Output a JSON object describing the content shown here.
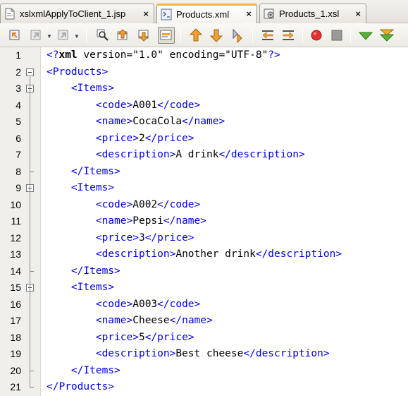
{
  "tabs": [
    {
      "label": "xslxmlApplyToClient_1.jsp",
      "icon": "jsp-file-icon",
      "active": false
    },
    {
      "label": "Products.xml",
      "icon": "xml-file-icon",
      "active": true
    },
    {
      "label": "Products_1.xsl",
      "icon": "xsl-file-icon",
      "active": false
    }
  ],
  "tab_close_glyph": "×",
  "toolbar": {
    "buttons": [
      "back-icon",
      "forward-icon",
      "history-icon",
      "find-icon",
      "find-previous-icon",
      "find-next-icon",
      "toggle-highlight-icon",
      "previous-bookmark-icon",
      "next-bookmark-icon",
      "toggle-bookmark-icon",
      "shift-left-icon",
      "shift-right-icon",
      "record-macro-icon",
      "stop-macro-icon",
      "check-xml-icon",
      "validate-xml-icon"
    ],
    "colors": {
      "arrow_orange": "#f0a030",
      "record_red": "#e03030",
      "validate_green": "#58b038"
    }
  },
  "editor": {
    "line_numbers": [
      "1",
      "2",
      "3",
      "4",
      "5",
      "6",
      "7",
      "8",
      "9",
      "10",
      "11",
      "12",
      "13",
      "14",
      "15",
      "16",
      "17",
      "18",
      "19",
      "20",
      "21"
    ],
    "lines": [
      "<?xml version=\"1.0\" encoding=\"UTF-8\"?>",
      "<Products>",
      "    <Items>",
      "        <code>A001</code>",
      "        <name>CocaCola</name>",
      "        <price>2</price>",
      "        <description>A drink</description>",
      "    </Items>",
      "    <Items>",
      "        <code>A002</code>",
      "        <name>Pepsi</name>",
      "        <price>3</price>",
      "        <description>Another drink</description>",
      "    </Items>",
      "    <Items>",
      "        <code>A003</code>",
      "        <name>Cheese</name>",
      "        <price>5</price>",
      "        <description>Best cheese</description>",
      "    </Items>",
      "</Products>"
    ],
    "tag_color": "#0000e6",
    "text_color": "#000000"
  }
}
